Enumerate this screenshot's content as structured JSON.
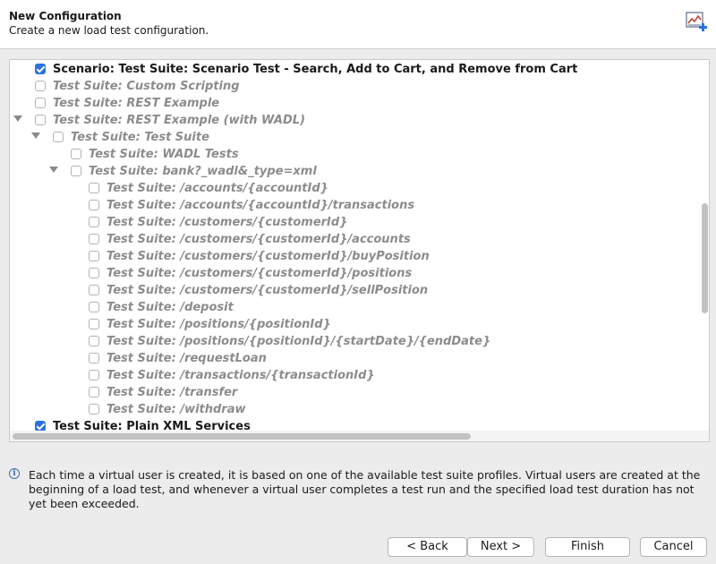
{
  "header": {
    "title": "New Configuration",
    "subtitle": "Create a new load test configuration.",
    "icon": "load-test-config-icon"
  },
  "tree": {
    "rows": [
      {
        "label": "Scenario: Test Suite: Scenario Test - Search, Add to Cart, and Remove from Cart",
        "level": 0,
        "checked": true,
        "enabled": true,
        "twisty": false
      },
      {
        "label": "Test Suite: Custom Scripting",
        "level": 0,
        "checked": false,
        "enabled": false,
        "twisty": false
      },
      {
        "label": "Test Suite: REST Example",
        "level": 0,
        "checked": false,
        "enabled": false,
        "twisty": false
      },
      {
        "label": "Test Suite: REST Example (with WADL)",
        "level": 0,
        "checked": false,
        "enabled": false,
        "twisty": true
      },
      {
        "label": "Test Suite: Test Suite",
        "level": 1,
        "checked": false,
        "enabled": false,
        "twisty": true
      },
      {
        "label": "Test Suite: WADL Tests",
        "level": 2,
        "checked": false,
        "enabled": false,
        "twisty": false
      },
      {
        "label": "Test Suite: bank?_wadl&_type=xml",
        "level": 2,
        "checked": false,
        "enabled": false,
        "twisty": true
      },
      {
        "label": "Test Suite: /accounts/{accountId}",
        "level": 3,
        "checked": false,
        "enabled": false,
        "twisty": false
      },
      {
        "label": "Test Suite: /accounts/{accountId}/transactions",
        "level": 3,
        "checked": false,
        "enabled": false,
        "twisty": false
      },
      {
        "label": "Test Suite: /customers/{customerId}",
        "level": 3,
        "checked": false,
        "enabled": false,
        "twisty": false
      },
      {
        "label": "Test Suite: /customers/{customerId}/accounts",
        "level": 3,
        "checked": false,
        "enabled": false,
        "twisty": false
      },
      {
        "label": "Test Suite: /customers/{customerId}/buyPosition",
        "level": 3,
        "checked": false,
        "enabled": false,
        "twisty": false
      },
      {
        "label": "Test Suite: /customers/{customerId}/positions",
        "level": 3,
        "checked": false,
        "enabled": false,
        "twisty": false
      },
      {
        "label": "Test Suite: /customers/{customerId}/sellPosition",
        "level": 3,
        "checked": false,
        "enabled": false,
        "twisty": false
      },
      {
        "label": "Test Suite: /deposit",
        "level": 3,
        "checked": false,
        "enabled": false,
        "twisty": false
      },
      {
        "label": "Test Suite: /positions/{positionId}",
        "level": 3,
        "checked": false,
        "enabled": false,
        "twisty": false
      },
      {
        "label": "Test Suite: /positions/{positionId}/{startDate}/{endDate}",
        "level": 3,
        "checked": false,
        "enabled": false,
        "twisty": false
      },
      {
        "label": "Test Suite: /requestLoan",
        "level": 3,
        "checked": false,
        "enabled": false,
        "twisty": false
      },
      {
        "label": "Test Suite: /transactions/{transactionId}",
        "level": 3,
        "checked": false,
        "enabled": false,
        "twisty": false
      },
      {
        "label": "Test Suite: /transfer",
        "level": 3,
        "checked": false,
        "enabled": false,
        "twisty": false
      },
      {
        "label": "Test Suite: /withdraw",
        "level": 3,
        "checked": false,
        "enabled": false,
        "twisty": false
      },
      {
        "label": "Test Suite: Plain XML Services",
        "level": 0,
        "checked": true,
        "enabled": true,
        "twisty": false
      }
    ]
  },
  "info": {
    "icon": "info-icon",
    "text": "Each time a virtual user is created, it is based on one of the available test suite profiles. Virtual users are created at the beginning of a load test, and whenever a virtual user completes a test run and the specified load test duration has not yet been exceeded."
  },
  "buttons": {
    "back": "< Back",
    "next": "Next >",
    "finish": "Finish",
    "cancel": "Cancel"
  },
  "colors": {
    "check_accent": "#2a70df",
    "disabled_text": "#8c8c8c"
  }
}
